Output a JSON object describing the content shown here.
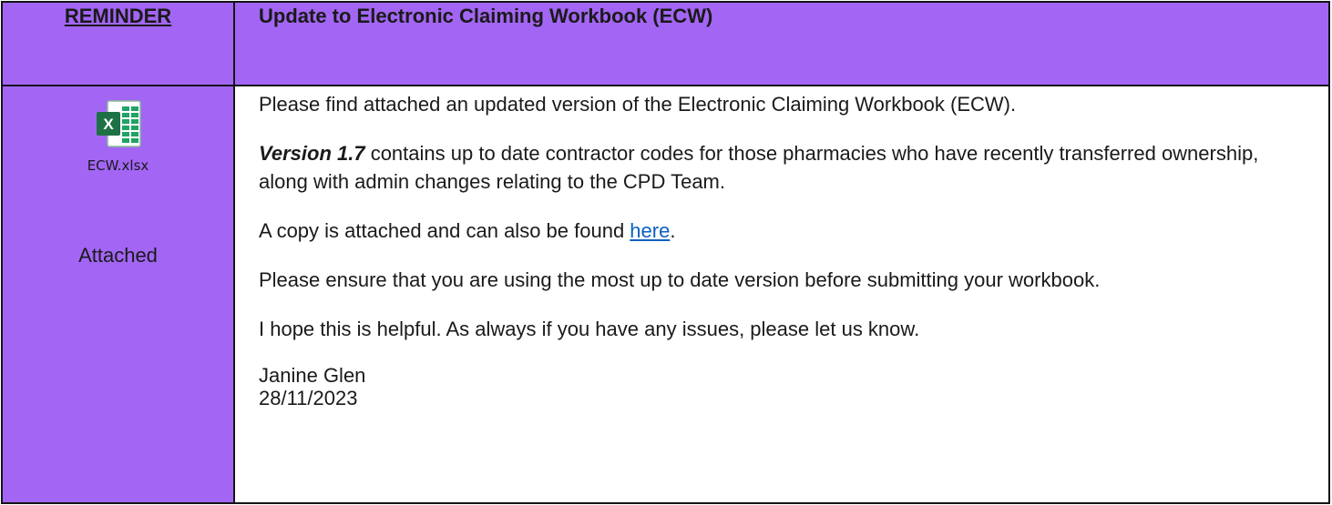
{
  "header": {
    "label": "REMINDER",
    "title": "Update to Electronic Claiming Workbook (ECW)"
  },
  "sidebar": {
    "attachment_icon": "excel-file-icon",
    "attachment_filename": "ECW.xlsx",
    "status": "Attached"
  },
  "body": {
    "paragraph1": "Please find attached an updated version of the Electronic Claiming Workbook (ECW).",
    "paragraph2_version": "Version 1.7",
    "paragraph2_rest": " contains up to date contractor codes for those pharmacies who have recently transferred ownership, along with admin changes relating to the CPD Team.",
    "paragraph3_before": "A copy is attached and can also be found ",
    "paragraph3_link": "here",
    "paragraph3_after": ".",
    "paragraph4": "Please ensure that you are using the most up to date version before submitting your workbook.",
    "paragraph5": "I hope this is helpful.  As always if you have any issues, please let us know.",
    "signature_name": "Janine Glen",
    "signature_date": "28/11/2023"
  },
  "colors": {
    "accent_purple": "#a366f4",
    "link_blue": "#0b61c1",
    "excel_green": "#1e7145"
  }
}
